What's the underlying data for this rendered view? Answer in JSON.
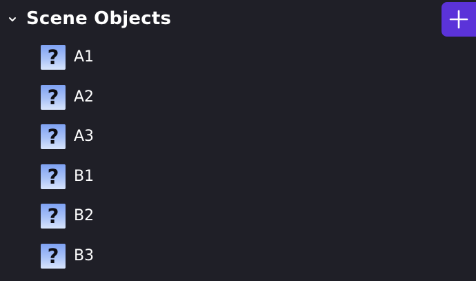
{
  "panel": {
    "title": "Scene Objects",
    "collapse_icon": "chevron-down-icon",
    "add_button_icon": "plus-icon",
    "accent_color": "#5b33d9",
    "background_color": "#1f1f27"
  },
  "objects": {
    "icon": "unknown-object-icon",
    "icon_glyph": "?",
    "items": [
      {
        "label": "A1"
      },
      {
        "label": "A2"
      },
      {
        "label": "A3"
      },
      {
        "label": "B1"
      },
      {
        "label": "B2"
      },
      {
        "label": "B3"
      }
    ]
  }
}
